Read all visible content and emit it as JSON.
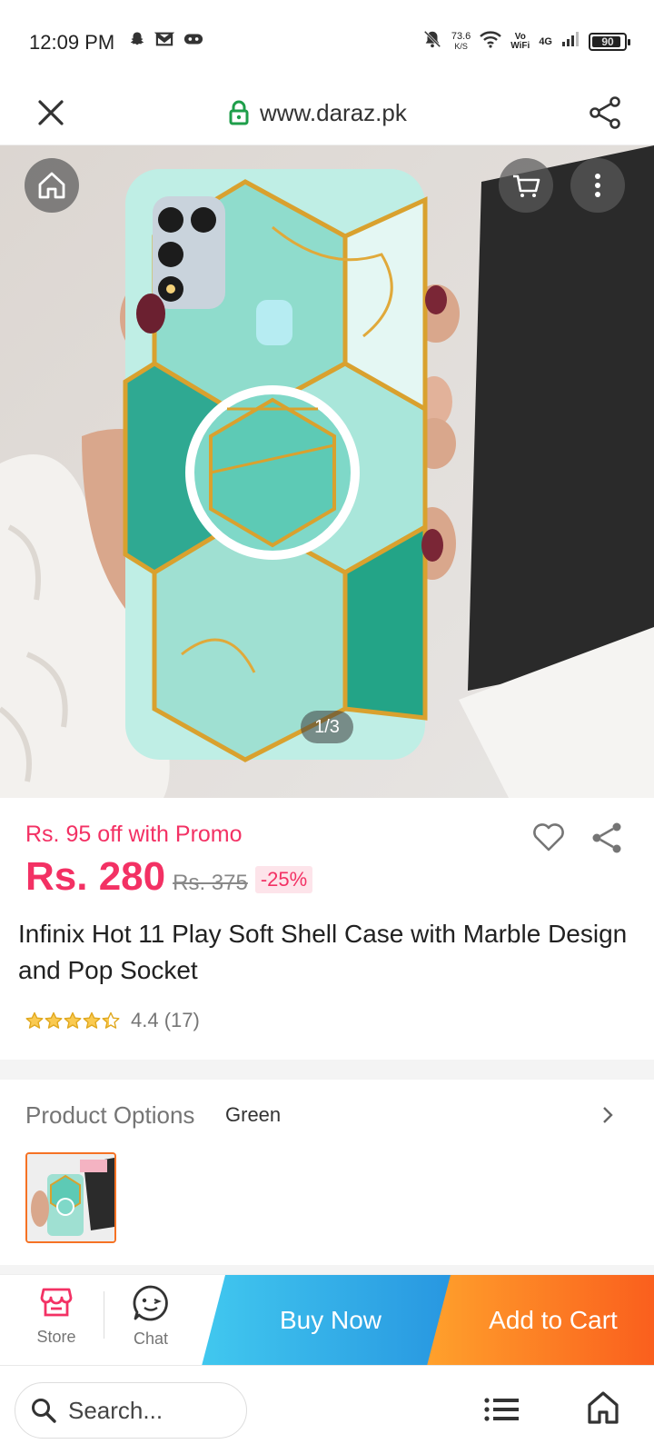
{
  "status_bar": {
    "time": "12:09 PM",
    "speed_value": "73.6",
    "speed_unit": "K/S",
    "vowifi_top": "Vo",
    "vowifi_bottom": "WiFi",
    "network": "4G",
    "battery": "90",
    "battery_level": 0.9,
    "left_icons": [
      "snapchat-icon",
      "mail-icon",
      "game-controller-icon"
    ],
    "right_icons": [
      "notifications-off-icon",
      "wifi-icon",
      "signal-icon"
    ]
  },
  "browser": {
    "url": "www.daraz.pk",
    "icons": [
      "close-icon",
      "lock-icon",
      "share-icon"
    ]
  },
  "gallery": {
    "counter": "1/3",
    "icons": [
      "home-icon",
      "cart-icon",
      "more-vertical-icon"
    ]
  },
  "product": {
    "promo_text": "Rs. 95 off with Promo",
    "price": "Rs. 280",
    "original_price": "Rs. 375",
    "discount": "-25%",
    "title": "Infinix Hot 11 Play Soft Shell Case with Marble Design and Pop Socket",
    "rating_value": 4.4,
    "rating_text": "4.4 (17)",
    "icons": [
      "heart-icon",
      "share-icon",
      "star-icon"
    ]
  },
  "options": {
    "label": "Product Options",
    "value": "Green",
    "icons": [
      "chevron-right-icon"
    ]
  },
  "actions": {
    "store_label": "Store",
    "chat_label": "Chat",
    "buy_now": "Buy Now",
    "add_to_cart": "Add to Cart",
    "icons": [
      "store-icon",
      "chat-icon"
    ]
  },
  "bottom_bar": {
    "search_placeholder": "Search...",
    "icons": [
      "search-icon",
      "menu-list-icon",
      "home-icon"
    ]
  },
  "colors": {
    "accent_pink": "#f33164",
    "buy_now_blue": "#2795e0",
    "add_to_cart_orange": "#fa5f1d",
    "selected_border": "#f57224"
  }
}
